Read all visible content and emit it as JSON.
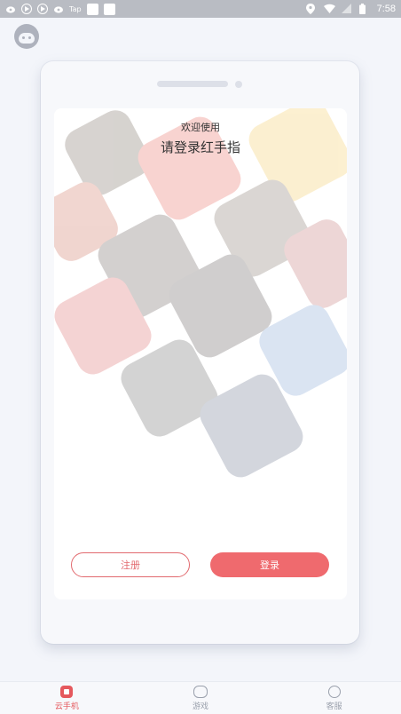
{
  "status_bar": {
    "tap_text": "Tap",
    "time": "7:58",
    "icons": [
      "weibo-icon",
      "play-icon",
      "play-icon",
      "weibo-icon",
      "square-icon",
      "square-icon",
      "location-icon",
      "wifi-icon",
      "signal-icon",
      "battery-icon"
    ]
  },
  "login_card": {
    "welcome": "欢迎使用",
    "headline": "请登录红手指",
    "register_label": "注册",
    "login_label": "登录"
  },
  "colors": {
    "accent": "#ef6a6e",
    "accent_dark": "#e5585d",
    "nav_inactive": "#9aa0ac"
  },
  "nav": {
    "items": [
      {
        "label": "云手机",
        "icon": "cloud-phone-icon",
        "active": true
      },
      {
        "label": "游戏",
        "icon": "gamepad-icon",
        "active": false
      },
      {
        "label": "客服",
        "icon": "headset-icon",
        "active": false
      }
    ]
  }
}
